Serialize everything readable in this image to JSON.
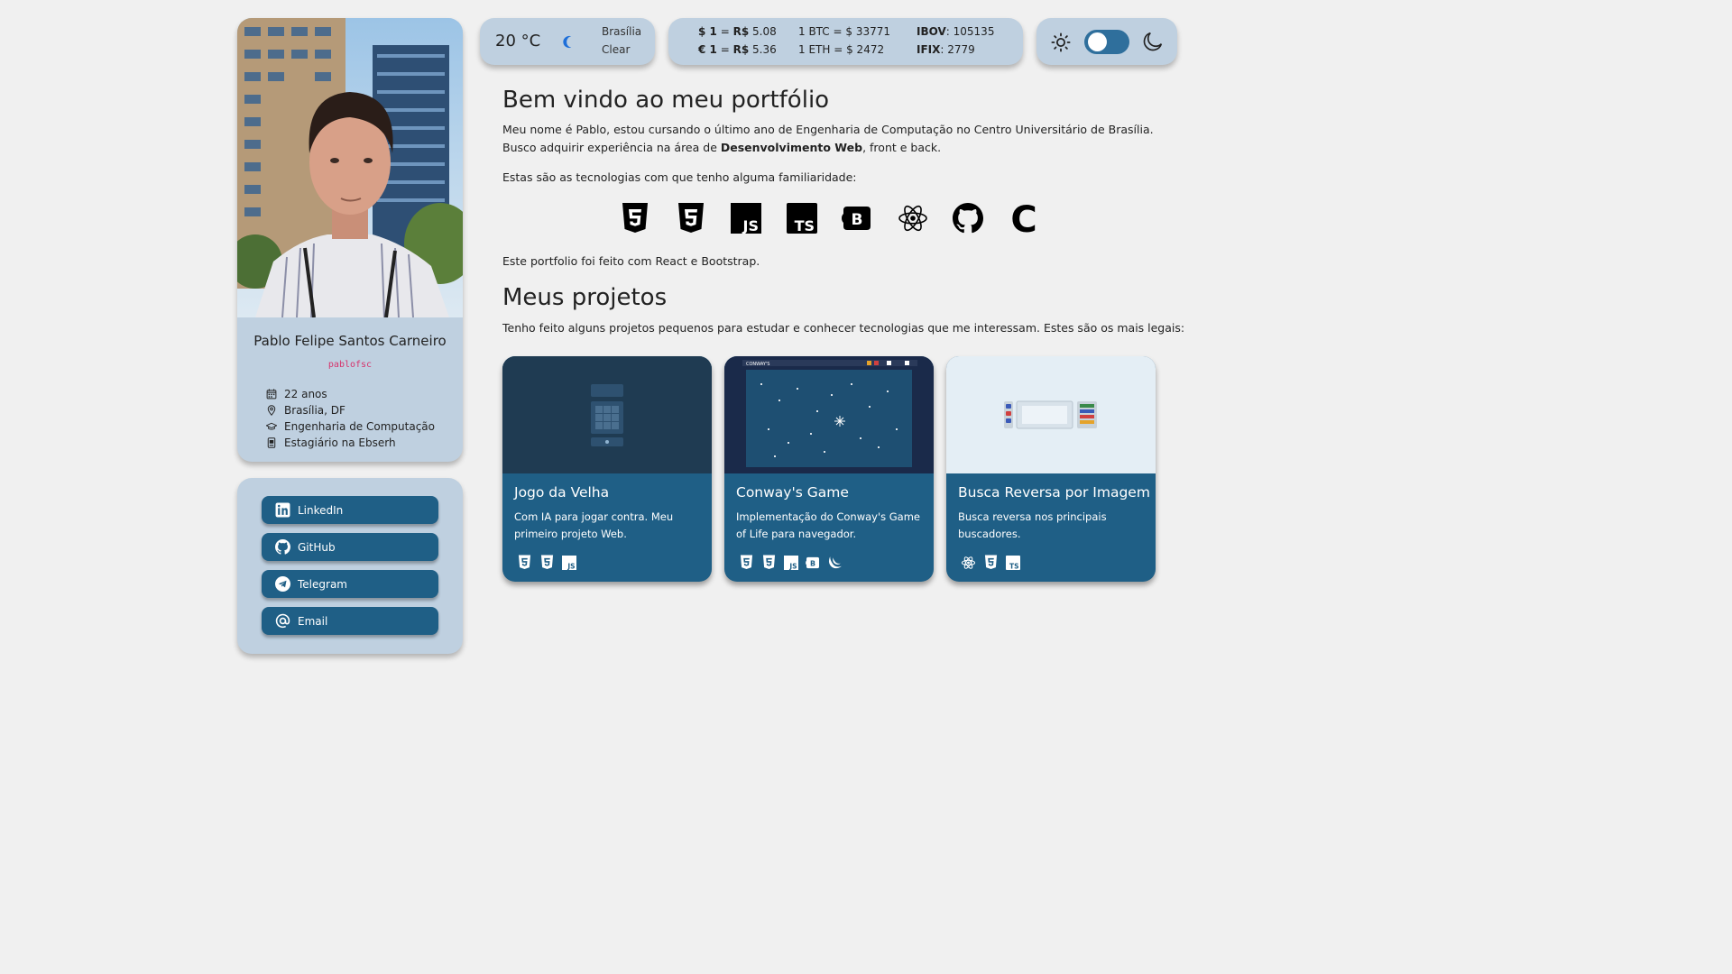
{
  "profile": {
    "photo_alt": "",
    "name": "Pablo Felipe Santos Carneiro",
    "username": "pablofsc",
    "info": [
      {
        "icon": "calendar-icon",
        "text": "22 anos"
      },
      {
        "icon": "location-pin-icon",
        "text": "Brasília, DF"
      },
      {
        "icon": "graduation-cap-icon",
        "text": "Engenharia de Computação"
      },
      {
        "icon": "badge-icon",
        "text": "Estagiário na Ebserh"
      }
    ]
  },
  "links": [
    {
      "icon": "linkedin-icon",
      "label": "LinkedIn"
    },
    {
      "icon": "github-icon",
      "label": "GitHub"
    },
    {
      "icon": "telegram-icon",
      "label": "Telegram"
    },
    {
      "icon": "at-sign-icon",
      "label": "Email"
    }
  ],
  "weather": {
    "temp": "20 °C",
    "icon": "moon-icon",
    "city": "Brasília",
    "condition": "Clear"
  },
  "rates": {
    "usd_sym": "$ 1",
    "usd_eq": "=",
    "usd_brl": "R$",
    "usd_val": "5.08",
    "eur_sym": "€ 1",
    "eur_eq": "=",
    "eur_brl": "R$",
    "eur_val": "5.36",
    "btc_sym": "1 BTC",
    "btc_eq": "=",
    "btc_val": "$ 33771",
    "eth_sym": "1 ETH",
    "eth_eq": "=",
    "eth_val": "$ 2472",
    "ibov_sym": "IBOV",
    "ibov_val": ": 105135",
    "ifix_sym": "IFIX",
    "ifix_val": ": 2779"
  },
  "theme": {
    "sun_icon": "sun-icon",
    "moon_icon": "moon-icon",
    "dark_mode": false
  },
  "main": {
    "welcome_title": "Bem vindo ao meu portfólio",
    "intro_line1": "Meu nome é Pablo, estou cursando o último ano de Engenharia de Computação no Centro Universitário de Brasília.",
    "intro_line2_a": "Busco adquirir experiência na área de ",
    "intro_line2_b": "Desenvolvimento Web",
    "intro_line2_c": ", front e back.",
    "tech_intro": "Estas são as tecnologias com que tenho alguma familiaridade:",
    "tech_icons": [
      "html5-icon",
      "css3-icon",
      "javascript-icon",
      "typescript-icon",
      "bootstrap-icon",
      "react-icon",
      "github-icon",
      "c-language-icon"
    ],
    "tech_texts": {
      "js": "JS",
      "ts": "TS",
      "b": "B",
      "c": "C"
    },
    "made_with": "Este portfolio foi feito com React e Bootstrap.",
    "projects_title": "Meus projetos",
    "projects_intro": "Tenho feito alguns projetos pequenos para estudar e conhecer tecnologias que me interessam. Estes são os mais legais:"
  },
  "projects": [
    {
      "title": "Jogo da Velha",
      "description": "Com IA para jogar contra. Meu primeiro projeto Web.",
      "tech": [
        "html5-icon",
        "css3-icon",
        "javascript-icon"
      ]
    },
    {
      "title": "Conway's Game",
      "description": "Implementação do Conway's Game of Life para navegador.",
      "tech": [
        "html5-icon",
        "css3-icon",
        "javascript-icon",
        "bootstrap-icon",
        "jquery-icon"
      ],
      "thumb_text": "CONWAY'S"
    },
    {
      "title": "Busca Reversa por Imagem",
      "description": "Busca reversa nos principais buscadores.",
      "tech": [
        "react-icon",
        "css3-icon",
        "typescript-icon"
      ]
    }
  ],
  "colors": {
    "background": "#f0f0f0",
    "card": "#bfd0e0",
    "accent": "#1f5f86",
    "toggle": "#2f6f9c",
    "username": "#d6336c"
  }
}
